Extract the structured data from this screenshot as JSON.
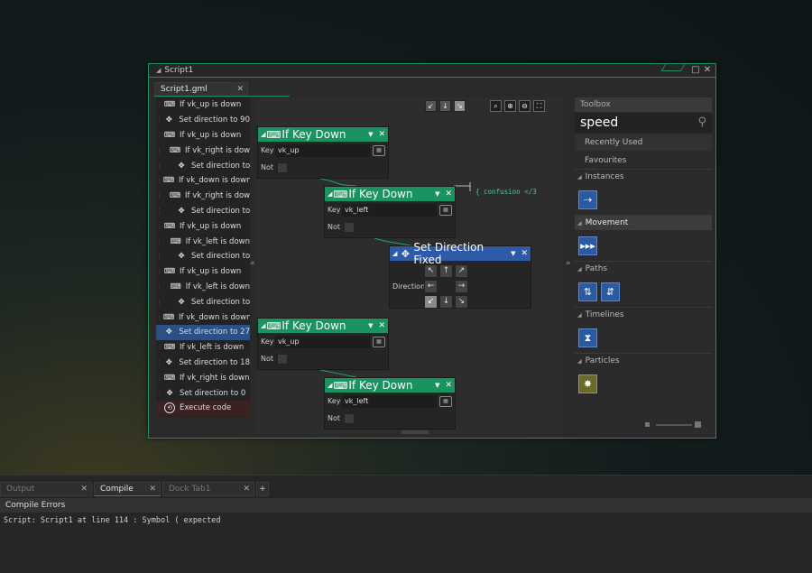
{
  "window": {
    "title": "Script1",
    "doc_tab": "Script1.gml",
    "max_icon": "□",
    "close_icon": "✕"
  },
  "actions": [
    {
      "label": "If vk_up is down",
      "icon": "keyboard-icon",
      "glyph": "⌨"
    },
    {
      "label": "Set direction to 90",
      "icon": "move-icon",
      "glyph": "✥"
    },
    {
      "label": "If vk_up is down",
      "icon": "keyboard-icon",
      "glyph": "⌨"
    },
    {
      "label": "If vk_right is down",
      "icon": "keyboard-icon",
      "glyph": "⌨"
    },
    {
      "label": "Set direction to",
      "icon": "move-icon",
      "glyph": "✥"
    },
    {
      "label": "If vk_down is down",
      "icon": "keyboard-icon",
      "glyph": "⌨"
    },
    {
      "label": "If vk_right is down",
      "icon": "keyboard-icon",
      "glyph": "⌨"
    },
    {
      "label": "Set direction to",
      "icon": "move-icon",
      "glyph": "✥"
    },
    {
      "label": "If vk_up is down",
      "icon": "keyboard-icon",
      "glyph": "⌨"
    },
    {
      "label": "If vk_left is down",
      "icon": "keyboard-icon",
      "glyph": "⌨"
    },
    {
      "label": "Set direction to",
      "icon": "move-icon",
      "glyph": "✥"
    },
    {
      "label": "If vk_up is down",
      "icon": "keyboard-icon",
      "glyph": "⌨"
    },
    {
      "label": "If vk_left is down",
      "icon": "keyboard-icon",
      "glyph": "⌨"
    },
    {
      "label": "Set direction to",
      "icon": "move-icon",
      "glyph": "✥"
    },
    {
      "label": "If vk_down is down",
      "icon": "keyboard-icon",
      "glyph": "⌨"
    },
    {
      "label": "Set direction to 27",
      "icon": "move-icon",
      "glyph": "✥"
    },
    {
      "label": "If vk_left is down",
      "icon": "keyboard-icon",
      "glyph": "⌨"
    },
    {
      "label": "Set direction to 18",
      "icon": "move-icon",
      "glyph": "✥"
    },
    {
      "label": "If vk_right is down",
      "icon": "keyboard-icon",
      "glyph": "⌨"
    },
    {
      "label": "Set direction to 0",
      "icon": "move-icon",
      "glyph": "✥"
    },
    {
      "label": "Execute code",
      "icon": "code-icon",
      "glyph": "⟲"
    }
  ],
  "blocks": {
    "key1": {
      "title": "If Key Down",
      "key_label": "Key",
      "key_value": "vk_up",
      "not_label": "Not"
    },
    "key2": {
      "title": "If Key Down",
      "key_label": "Key",
      "key_value": "vk_left",
      "not_label": "Not"
    },
    "setdir": {
      "title": "Set Direction Fixed",
      "direction_label": "Direction"
    },
    "key3": {
      "title": "If Key Down",
      "key_label": "Key",
      "key_value": "vk_up",
      "not_label": "Not"
    },
    "key4": {
      "title": "If Key Down",
      "key_label": "Key",
      "key_value": "vk_left",
      "not_label": "Not"
    }
  },
  "comment": "{ confusion </3",
  "toolbox": {
    "header": "Toolbox",
    "search_value": "speed",
    "recently_used": "Recently Used",
    "favourites": "Favourites",
    "categories": {
      "instances": "Instances",
      "movement": "Movement",
      "paths": "Paths",
      "timelines": "Timelines",
      "particles": "Particles"
    }
  },
  "dock": {
    "tabs": {
      "output": "Output",
      "compile_errors": "Compile Errors",
      "dock_tab": "Dock Tab1",
      "add": "+"
    },
    "panel_title": "Compile Errors",
    "message": "Script: Script1 at line 114 : Symbol ( expected"
  },
  "colors": {
    "accent": "#1f8f62",
    "block_header": "#19935f",
    "selected": "#2c4f86"
  }
}
